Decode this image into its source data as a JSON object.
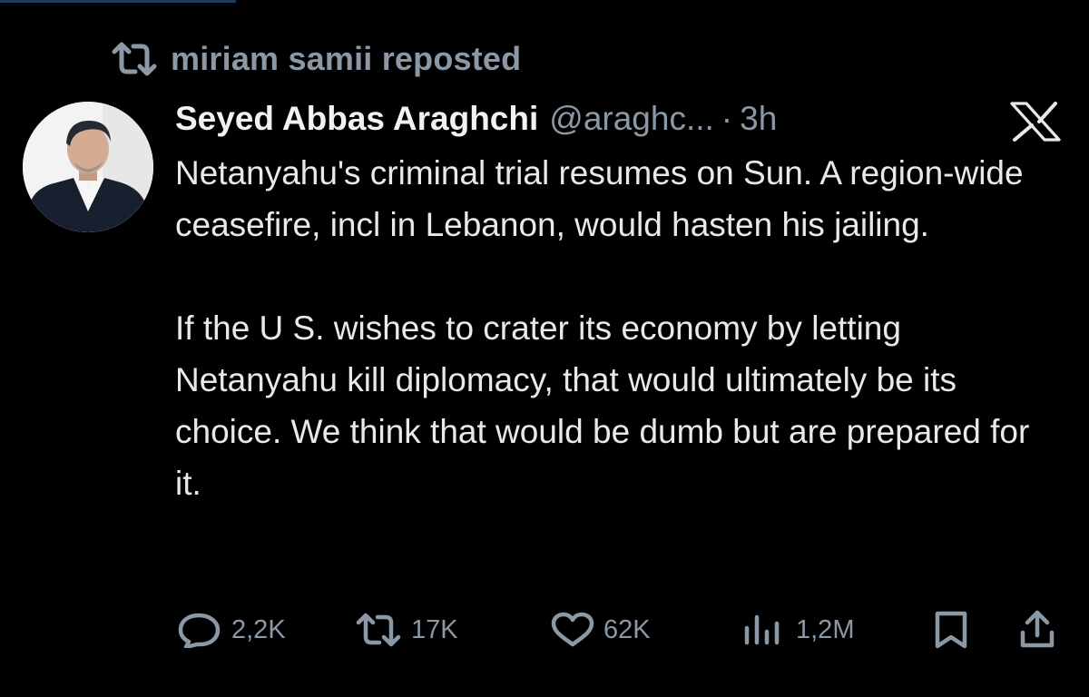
{
  "repost": {
    "label": "miriam samii reposted"
  },
  "tweet": {
    "display_name": "Seyed Abbas Araghchi",
    "handle": "@araghc...",
    "separator": "·",
    "time": "3h",
    "paragraphs": [
      "Netanyahu's criminal trial resumes on Sun. A region-wide ceasefire, incl in Lebanon, would hasten his jailing.",
      "If the U S. wishes to crater its economy by letting Netanyahu kill diplomacy, that would ultimately be its choice. We think that would be dumb but are prepared for it."
    ]
  },
  "actions": {
    "replies": "2,2K",
    "reposts": "17K",
    "likes": "62K",
    "views": "1,2M"
  },
  "icons": {
    "repost": "repost-icon",
    "platform": "x-logo-icon",
    "reply": "reply-icon",
    "like": "heart-icon",
    "views": "views-icon",
    "bookmark": "bookmark-icon",
    "share": "share-icon"
  },
  "colors": {
    "background": "#000000",
    "text_primary": "#e7e9ea",
    "text_secondary": "#8b98a5"
  }
}
